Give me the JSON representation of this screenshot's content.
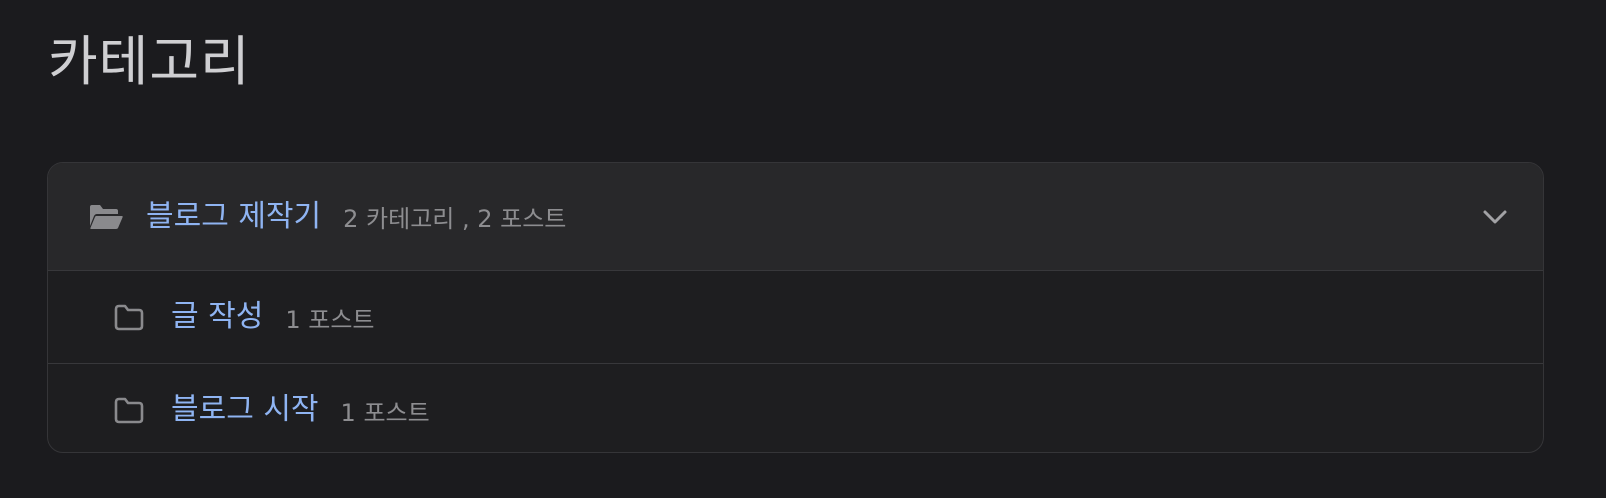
{
  "page": {
    "title": "카테고리"
  },
  "group": {
    "name": "블로그 제작기",
    "meta": "2 카테고리 , 2 포스트",
    "icon": "folder-open-icon",
    "toggle_icon": "chevron-down-icon"
  },
  "subcategories": [
    {
      "name": "글 작성",
      "meta": "1 포스트",
      "icon": "folder-icon"
    },
    {
      "name": "블로그 시작",
      "meta": "1 포스트",
      "icon": "folder-icon"
    }
  ],
  "colors": {
    "background": "#1b1b1e",
    "card_background": "#1e1e20",
    "header_background": "#28282a",
    "link": "#8fb4f2",
    "muted_text": "#8d8d90",
    "title_text": "#cfcfd2"
  }
}
